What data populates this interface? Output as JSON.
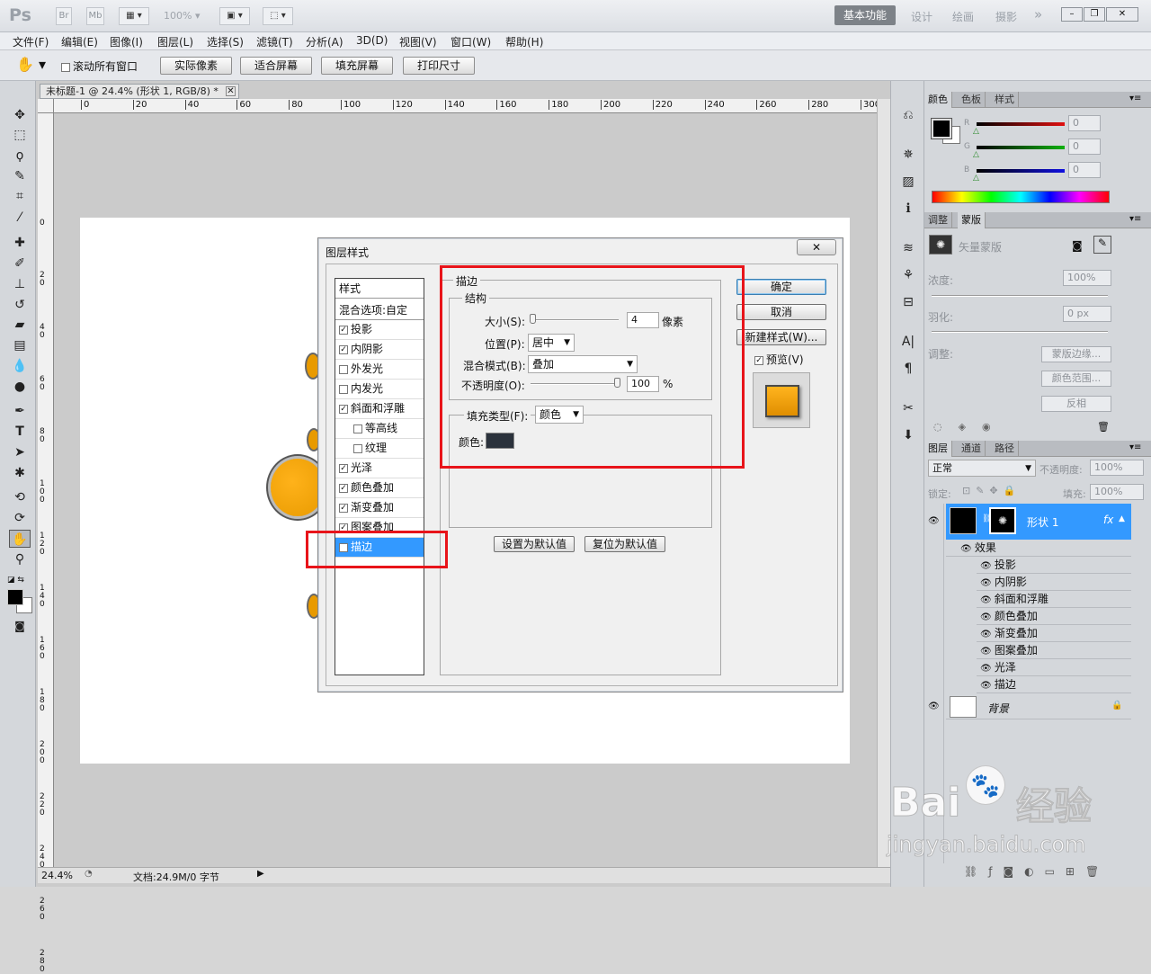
{
  "app": {
    "logo": "Ps",
    "br": "Br",
    "mb": "Mb",
    "zoom": "100%"
  },
  "workspaces": {
    "active": "基本功能",
    "items": [
      "设计",
      "绘画",
      "摄影"
    ],
    "more": "»"
  },
  "window_controls": {
    "minimize": "–",
    "restore": "❐",
    "close": "✕"
  },
  "menu": [
    "文件(F)",
    "编辑(E)",
    "图像(I)",
    "图层(L)",
    "选择(S)",
    "滤镜(T)",
    "分析(A)",
    "3D(D)",
    "视图(V)",
    "窗口(W)",
    "帮助(H)"
  ],
  "options_bar": {
    "scroll_all_label": "滚动所有窗口",
    "buttons": [
      "实际像素",
      "适合屏幕",
      "填充屏幕",
      "打印尺寸"
    ]
  },
  "document": {
    "tab_title": "未标题-1 @ 24.4% (形状 1, RGB/8) *",
    "ruler_h": [
      "0",
      "20",
      "40",
      "60",
      "80",
      "100",
      "120",
      "140",
      "160",
      "180",
      "200",
      "220",
      "240",
      "260",
      "280",
      "300"
    ],
    "ruler_v": [
      "0",
      "2 0",
      "4 0",
      "6 0",
      "8 0",
      "1 0 0",
      "1 2 0",
      "1 4 0",
      "1 6 0",
      "1 8 0",
      "2 0 0",
      "2 2 0",
      "2 4 0",
      "2 6 0",
      "2 8 0"
    ],
    "zoom": "24.4%",
    "doc_size": "文档:24.9M/0 字节"
  },
  "dialog": {
    "title": "图层样式",
    "close": "✕",
    "styles_header": "样式",
    "blend_options": "混合选项:自定",
    "styles": [
      {
        "label": "投影",
        "checked": true,
        "indent": false
      },
      {
        "label": "内阴影",
        "checked": true,
        "indent": false
      },
      {
        "label": "外发光",
        "checked": false,
        "indent": false
      },
      {
        "label": "内发光",
        "checked": false,
        "indent": false
      },
      {
        "label": "斜面和浮雕",
        "checked": true,
        "indent": false
      },
      {
        "label": "等高线",
        "checked": false,
        "indent": true
      },
      {
        "label": "纹理",
        "checked": false,
        "indent": true
      },
      {
        "label": "光泽",
        "checked": true,
        "indent": false
      },
      {
        "label": "颜色叠加",
        "checked": true,
        "indent": false
      },
      {
        "label": "渐变叠加",
        "checked": true,
        "indent": false
      },
      {
        "label": "图案叠加",
        "checked": true,
        "indent": false
      },
      {
        "label": "描边",
        "checked": true,
        "indent": false,
        "selected": true
      }
    ],
    "stroke": {
      "section": "描边",
      "structure": "结构",
      "size_label": "大小(S):",
      "size_value": "4",
      "size_unit": "像素",
      "position_label": "位置(P):",
      "position_value": "居中",
      "blend_label": "混合模式(B):",
      "blend_value": "叠加",
      "opacity_label": "不透明度(O):",
      "opacity_value": "100",
      "opacity_unit": "%",
      "fill_type_label": "填充类型(F):",
      "fill_type_value": "颜色",
      "color_label": "颜色:",
      "color_hex": "#2b323c",
      "default_btn": "设置为默认值",
      "reset_btn": "复位为默认值"
    },
    "buttons": {
      "ok": "确定",
      "cancel": "取消",
      "new_style": "新建样式(W)...",
      "preview": "预览(V)"
    }
  },
  "color_panel": {
    "tabs": [
      "颜色",
      "色板",
      "样式"
    ],
    "channels": [
      {
        "name": "R",
        "value": "0",
        "color": "#e01010"
      },
      {
        "name": "G",
        "value": "0",
        "color": "#10b010"
      },
      {
        "name": "B",
        "value": "0",
        "color": "#1010e0"
      }
    ]
  },
  "masks_panel": {
    "tabs": [
      "调整",
      "蒙版"
    ],
    "vector_mask": "矢量蒙版",
    "density_label": "浓度:",
    "density_value": "100%",
    "feather_label": "羽化:",
    "feather_value": "0 px",
    "adjust_label": "调整:",
    "buttons": [
      "蒙版边缘...",
      "颜色范围...",
      "反相"
    ]
  },
  "layers_panel": {
    "tabs": [
      "图层",
      "通道",
      "路径"
    ],
    "blend_mode": "正常",
    "opacity_label": "不透明度:",
    "opacity_value": "100%",
    "lock_label": "锁定:",
    "fill_label": "填充:",
    "fill_value": "100%",
    "layer_name": "形状 1",
    "fx": "fx",
    "effects_label": "效果",
    "effects": [
      "投影",
      "内阴影",
      "斜面和浮雕",
      "颜色叠加",
      "渐变叠加",
      "图案叠加",
      "光泽",
      "描边"
    ],
    "background": "背景"
  },
  "watermark": {
    "line1": "Bai",
    "line2": "经验",
    "url": "jingyan.baidu.com"
  }
}
